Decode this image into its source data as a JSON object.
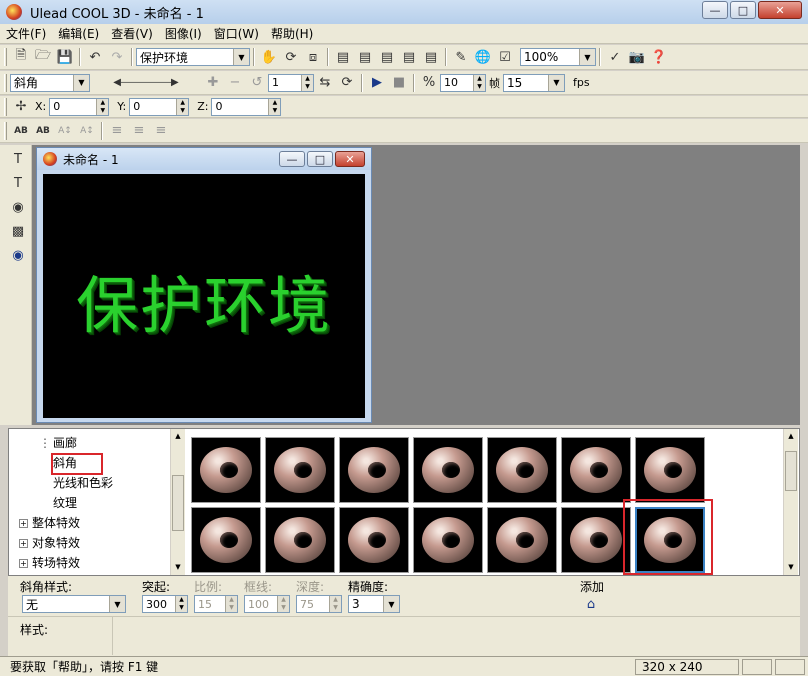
{
  "window": {
    "title": "Ulead COOL 3D - 未命名 - 1"
  },
  "menu": [
    "文件(F)",
    "编辑(E)",
    "查看(V)",
    "图像(I)",
    "窗口(W)",
    "帮助(H)"
  ],
  "toolbar1": {
    "text_combo": "保护环境",
    "zoom_combo": "100%"
  },
  "toolbar2": {
    "effect_combo": "斜角",
    "frame_value": "1",
    "frame_count": "10",
    "frame_label": "帧",
    "fps_value": "15",
    "fps_label": "fps"
  },
  "toolbar3": {
    "x_label": "X:",
    "x_value": "0",
    "y_label": "Y:",
    "y_value": "0",
    "z_label": "Z:",
    "z_value": "0"
  },
  "child_window": {
    "title": "未命名 - 1",
    "text_3d": "保护环境",
    "text_color": "#2ad12e"
  },
  "tree": {
    "items": [
      {
        "label": "画廊",
        "expandable": false
      },
      {
        "label": "斜角",
        "expandable": false,
        "selected": true
      },
      {
        "label": "光线和色彩",
        "expandable": false
      },
      {
        "label": "纹理",
        "expandable": false
      },
      {
        "label": "整体特效",
        "expandable": true
      },
      {
        "label": "对象特效",
        "expandable": true
      },
      {
        "label": "转场特效",
        "expandable": true
      }
    ]
  },
  "gallery": {
    "rows": 2,
    "columns": 7,
    "selected_index": 13
  },
  "bevel": {
    "style_label": "斜角样式:",
    "style_value": "无",
    "protrude_label": "突起:",
    "protrude_value": "300",
    "ratio_label": "比例:",
    "ratio_value": "15",
    "border_label": "框线:",
    "border_value": "100",
    "depth_label": "深度:",
    "depth_value": "75",
    "precision_label": "精确度:",
    "precision_value": "3",
    "add_label": "添加"
  },
  "styles": {
    "label": "样式:"
  },
  "status": {
    "text": "要获取「帮助」，请按 F1 键",
    "size": "320 x 240"
  },
  "colors": {
    "highlight": "#d9262b",
    "selection": "#3b82c4",
    "text3d": "#2ad12e"
  }
}
